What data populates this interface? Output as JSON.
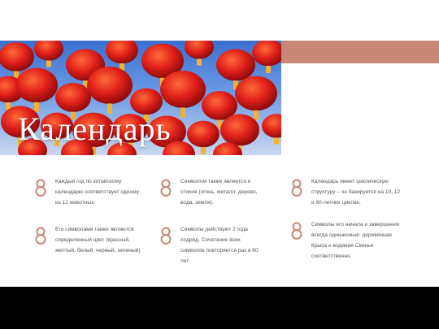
{
  "slide": {
    "title": "Календарь",
    "accent_color": "#c98778",
    "items": [
      {
        "icon": "figure-eight-icon",
        "text": "Каждый год по китайскому календарю соответствует одному из 12 животных."
      },
      {
        "icon": "figure-eight-icon",
        "text": "Символом также является и стихия (огонь, металл, дерево, вода, земля)."
      },
      {
        "icon": "figure-eight-icon",
        "text": "Календарь имеет циклическую структуру – он базируется на 10, 12 и 60-летних циклах."
      },
      {
        "icon": "figure-eight-icon",
        "text": "Его символами также являются определенный цвет (красный, желтый, белый, черный, зеленый)"
      },
      {
        "icon": "figure-eight-icon",
        "text": "Символы действуют 2 года подряд. Сочетание всех символов повторяется раз в 60 лет."
      },
      {
        "icon": "figure-eight-icon",
        "text": "Символы его начала и завершения всегда одинаковые: деревянная Крыса и водяная Свинья соответственно."
      }
    ]
  }
}
